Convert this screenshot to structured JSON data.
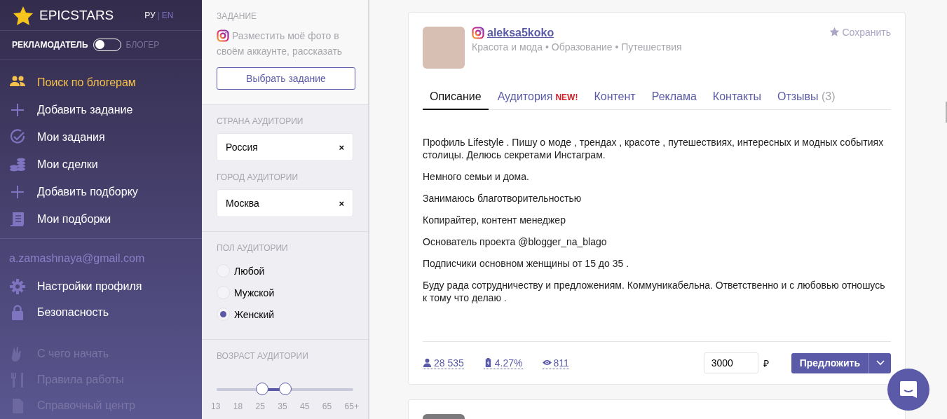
{
  "sidebar": {
    "logo": "EPICSTARS",
    "language_separator": "|",
    "languages": [
      {
        "label": "РУ",
        "selected": true
      },
      {
        "label": "EN",
        "selected": false
      }
    ],
    "role_switch": {
      "left_label": "РЕКЛАМОДАТЕЛЬ",
      "right_label": "БЛОГЕР",
      "on": false
    },
    "nav": [
      {
        "label": "Поиск по блогерам",
        "selected": true,
        "disabled": false
      },
      {
        "label": "Добавить задание",
        "selected": false,
        "disabled": false
      },
      {
        "label": "Мои задания",
        "selected": false,
        "disabled": false
      },
      {
        "label": "Мои сделки",
        "selected": false,
        "disabled": false
      },
      {
        "label": "Добавить подборку",
        "selected": false,
        "disabled": false
      },
      {
        "label": "Мои подборки",
        "selected": false,
        "disabled": false
      }
    ],
    "email": "a.zamashnaya@gmail.com",
    "account": [
      {
        "label": "Настройки профиля",
        "selected": false,
        "disabled": false
      },
      {
        "label": "Безопасность",
        "selected": false,
        "disabled": false
      }
    ],
    "help": [
      {
        "label": "С чего начать",
        "disabled": true
      },
      {
        "label": "Правила работы",
        "disabled": true
      },
      {
        "label": "Справочный центр",
        "disabled": true
      }
    ]
  },
  "filters": {
    "task": {
      "heading": "ЗАДАНИЕ",
      "text": "Разместить моё фото в своём аккаунте, рассказать",
      "button": "Выбрать задание"
    },
    "country": {
      "heading": "СТРАНА АУДИТОРИИ",
      "value": "Россия",
      "clear": "×"
    },
    "city": {
      "heading": "ГОРОД АУДИТОРИИ",
      "value": "Москва",
      "clear": "×"
    },
    "gender": {
      "heading": "ПОЛ АУДИТОРИИ",
      "options": [
        {
          "label": "Любой",
          "selected": false
        },
        {
          "label": "Мужской",
          "selected": false
        },
        {
          "label": "Женский",
          "selected": true
        }
      ]
    },
    "age": {
      "heading": "ВОЗРАСТ АУДИТОРИИ",
      "thumbs": [
        {
          "level": 0.333
        },
        {
          "level": 0.5
        }
      ],
      "ticks": [
        "13",
        "18",
        "25",
        "35",
        "45",
        "65",
        "65+"
      ]
    }
  },
  "profile": {
    "username": "aleksa5koko",
    "categories": "Красота и мода • Образование • Путешествия",
    "save": "Сохранить",
    "tabs": [
      {
        "label": "Описание",
        "selected": true
      },
      {
        "label": "Аудитория",
        "badge": "NEW!",
        "selected": false
      },
      {
        "label": "Контент",
        "selected": false
      },
      {
        "label": "Реклама",
        "selected": false
      },
      {
        "label": "Контакты",
        "selected": false
      },
      {
        "label": "Отзывы",
        "count": "(3)",
        "selected": false
      }
    ],
    "description": [
      "Профиль Lifestyle .  Пишу о моде , трендах , красоте , путешествиях, интересных и модных событиях столицы. Делюсь секретами Инстаграм.",
      "Немного семьи и дома.",
      "Занимаюсь благотворительностью",
      "Копирайтер, контент менеджер",
      "Основатель проекта @blogger_na_blago",
      "Подписчики основном женщины от 15 до 35 .",
      "Буду рада сотрудничеству и предложениям. Коммуникабельна. Ответственно  и с любовью отношусь к тому что делаю ."
    ],
    "stats": [
      {
        "kind": "followers",
        "value": "28 535"
      },
      {
        "kind": "engagement",
        "value": "4.27%"
      },
      {
        "kind": "views",
        "value": "811"
      }
    ],
    "price": {
      "value": "3000",
      "currency": "₽"
    },
    "offer_button": "Предложить"
  }
}
